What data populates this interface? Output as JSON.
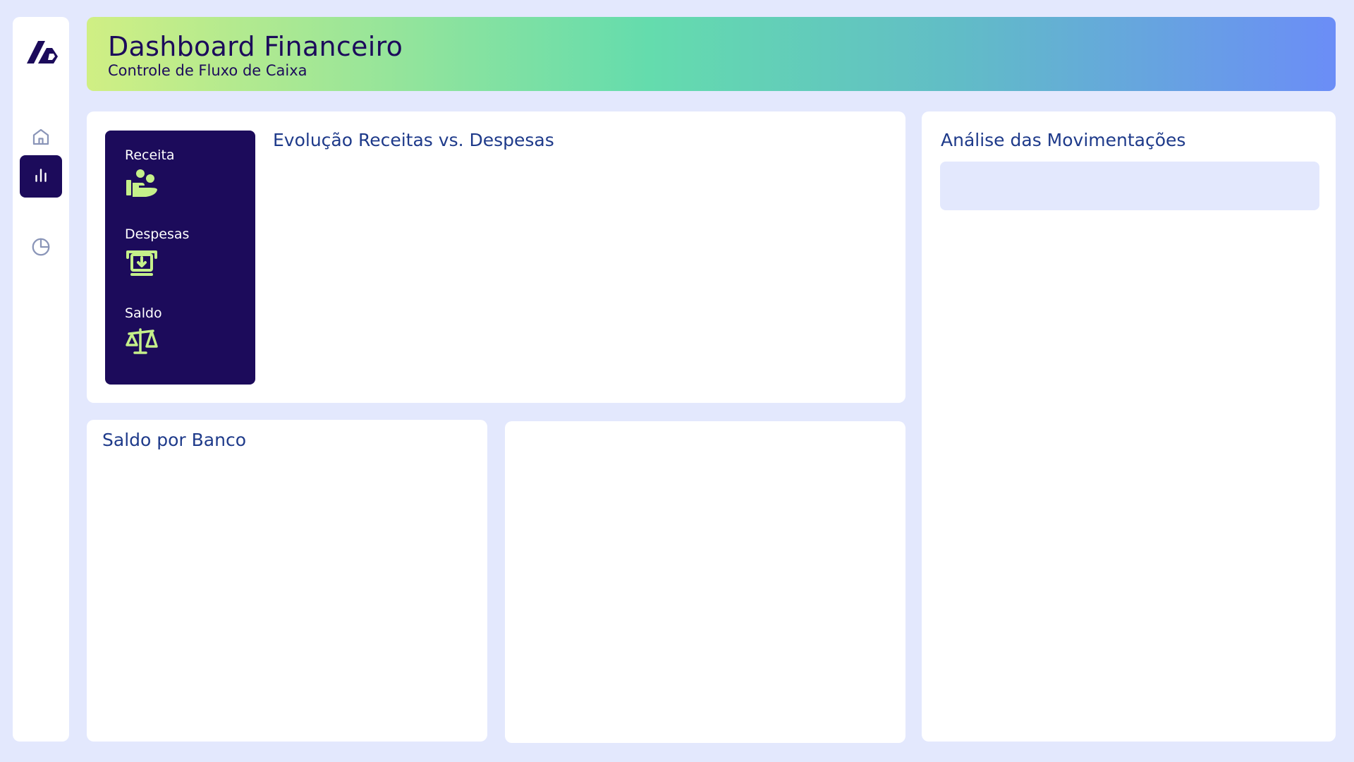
{
  "sidebar": {
    "logo_icon": "brand-logo-icon",
    "items": [
      {
        "name": "home",
        "icon": "home-icon",
        "active": false
      },
      {
        "name": "charts",
        "icon": "bar-chart-icon",
        "active": true
      },
      {
        "name": "pie",
        "icon": "pie-chart-icon",
        "active": false
      }
    ]
  },
  "header": {
    "title": "Dashboard Financeiro",
    "subtitle": "Controle de Fluxo de Caixa"
  },
  "evolucao": {
    "title": "Evolução Receitas vs. Despesas",
    "kpis": [
      {
        "label": "Receita",
        "icon": "hand-coins-icon"
      },
      {
        "label": "Despesas",
        "icon": "atm-withdraw-icon"
      },
      {
        "label": "Saldo",
        "icon": "scale-balance-icon"
      }
    ]
  },
  "analise": {
    "title": "Análise das Movimentações"
  },
  "banco": {
    "title": "Saldo por Banco"
  },
  "colors": {
    "background": "#e3e8fd",
    "primary_dark": "#1c0b5b",
    "accent_green": "#c5f08a",
    "title_blue": "#1e3a8a"
  }
}
